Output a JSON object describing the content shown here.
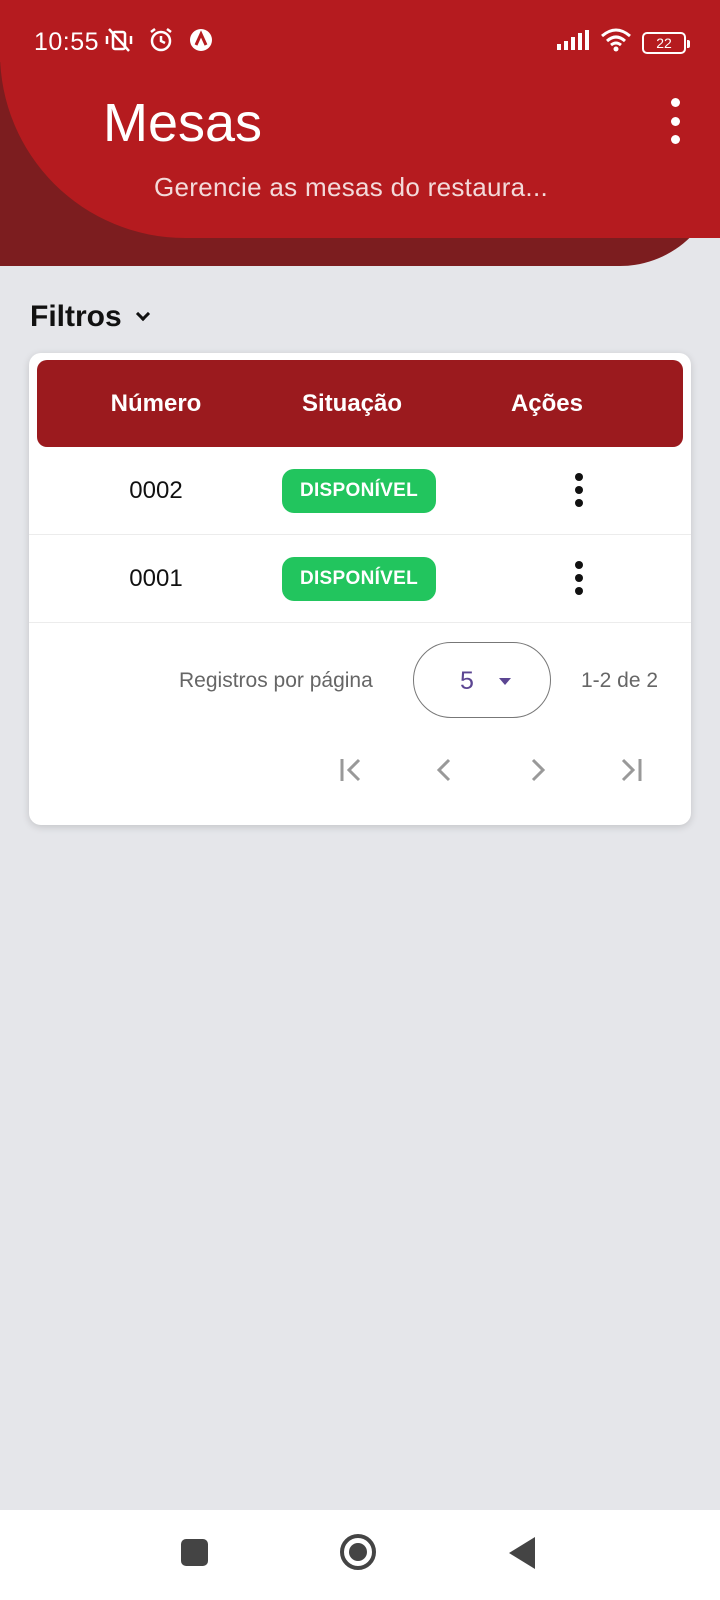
{
  "status_bar": {
    "time": "10:55",
    "battery": "22",
    "icons_left": [
      "vibrate-off-icon",
      "alarm-icon",
      "app-notification-icon"
    ],
    "icons_right": [
      "signal-icon",
      "wifi-icon",
      "battery-icon"
    ]
  },
  "header": {
    "title": "Mesas",
    "subtitle": "Gerencie as mesas do restaura...",
    "menu_icon": "more-vert-icon"
  },
  "filters": {
    "label": "Filtros",
    "icon": "chevron-down-icon"
  },
  "table": {
    "columns": [
      "Número",
      "Situação",
      "Ações"
    ],
    "rows": [
      {
        "numero": "0002",
        "situacao": "DISPONÍVEL",
        "acoes_icon": "more-vert-icon"
      },
      {
        "numero": "0001",
        "situacao": "DISPONÍVEL",
        "acoes_icon": "more-vert-icon"
      }
    ],
    "status_color": "#22c55e",
    "header_color": "#9b1a1e"
  },
  "pagination": {
    "rows_per_page_label": "Registros por página",
    "rows_per_page_value": "5",
    "range": "1-2 de 2",
    "buttons": [
      "first-page-icon",
      "prev-page-icon",
      "next-page-icon",
      "last-page-icon"
    ]
  },
  "theme": {
    "primary": "#b51b1f",
    "primary_dark": "#7c1d1f",
    "background": "#e5e6ea"
  },
  "system_nav": [
    "recents-button",
    "home-button",
    "back-button"
  ]
}
